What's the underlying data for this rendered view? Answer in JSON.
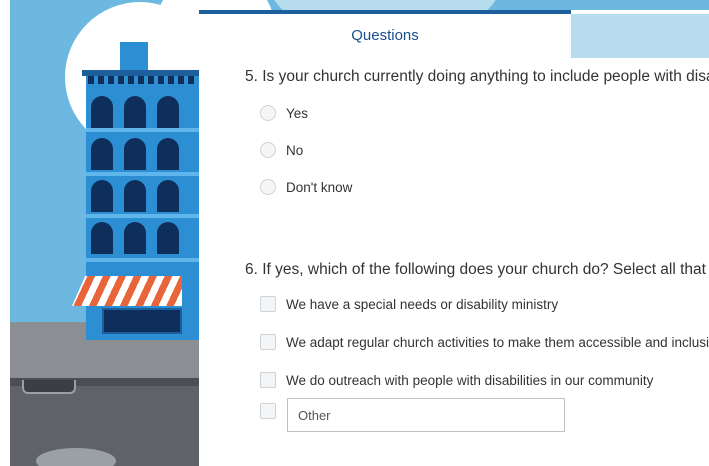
{
  "panel": {
    "title": "Questions"
  },
  "questions": [
    {
      "number": "5.",
      "text": "Is your church currently doing anything to include people with disa",
      "type": "radio",
      "options": [
        "Yes",
        "No",
        "Don't know"
      ]
    },
    {
      "number": "6.",
      "text": "If yes, which of the following does your church do? Select all that a",
      "type": "checkbox",
      "options": [
        "We have a special needs or disability ministry",
        "We adapt regular church activities to make them accessible and inclusiv",
        "We do outreach with people with disabilities in our community"
      ],
      "other_placeholder": "Other"
    }
  ],
  "colors": {
    "sky": "#6cb8e0",
    "building": "#2d8fd3",
    "window": "#0e2f5c",
    "title_text": "#1a4f8a",
    "awning_stripe": "#e8643a"
  }
}
